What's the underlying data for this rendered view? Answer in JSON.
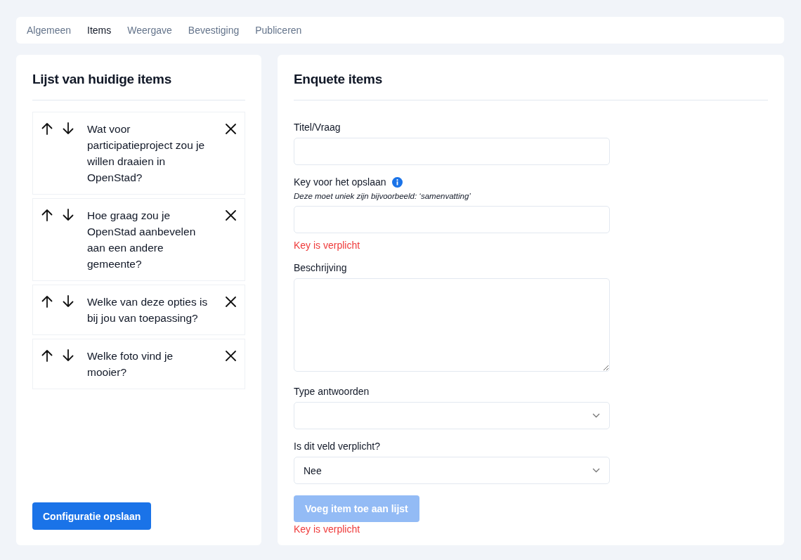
{
  "tabs": [
    {
      "label": "Algemeen",
      "selected": false
    },
    {
      "label": "Items",
      "selected": true
    },
    {
      "label": "Weergave",
      "selected": false
    },
    {
      "label": "Bevestiging",
      "selected": false
    },
    {
      "label": "Publiceren",
      "selected": false
    }
  ],
  "items_panel": {
    "title": "Lijst van huidige items",
    "items": [
      {
        "text": "Wat voor participatieproject zou je willen draaien in OpenStad?"
      },
      {
        "text": "Hoe graag zou je OpenStad aanbevelen aan een andere gemeente?"
      },
      {
        "text": "Welke van deze opties is bij jou van toepassing?"
      },
      {
        "text": "Welke foto vind je mooier?"
      }
    ],
    "save_button": {
      "label": "Configuratie opslaan"
    }
  },
  "form_panel": {
    "title": "Enquete items",
    "fields": [
      {
        "kind": "text",
        "label": "Titel/Vraag"
      },
      {
        "kind": "text",
        "label": "Key voor het opslaan",
        "info": true,
        "hint": "Deze moet uniek zijn bijvoorbeeld: ‘samenvatting’",
        "error": "Key is verplicht"
      },
      {
        "kind": "textarea",
        "label": "Beschrijving"
      },
      {
        "kind": "select",
        "label": "Type antwoorden"
      },
      {
        "kind": "select",
        "label": "Is dit veld verplicht?",
        "value": "Nee"
      }
    ],
    "submit_button": {
      "label": "Voeg item toe aan lijst",
      "disabled": true
    },
    "submit_error": "Key is verplicht"
  }
}
